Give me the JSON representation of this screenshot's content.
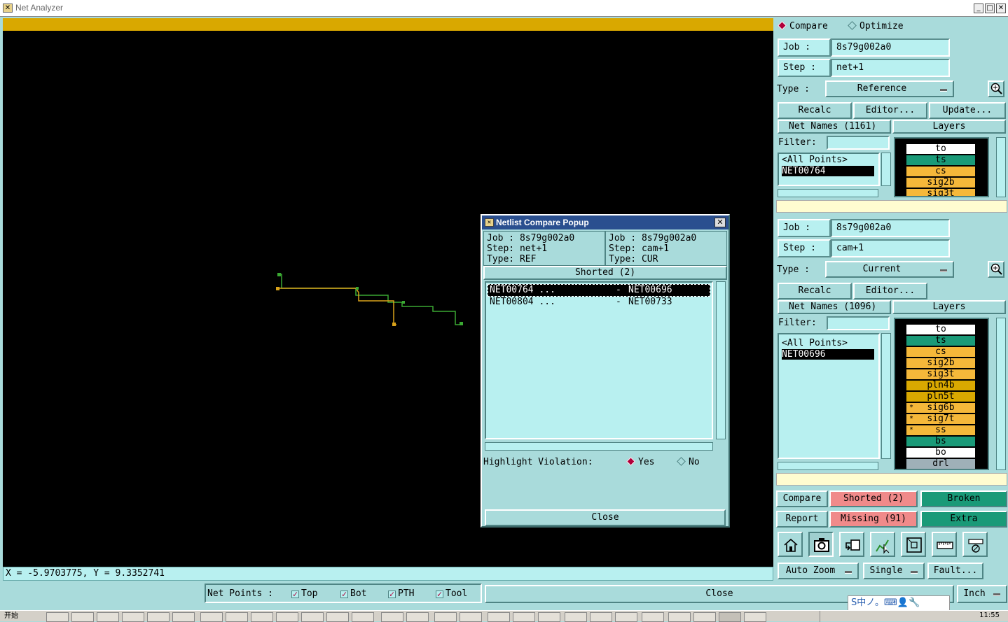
{
  "window": {
    "title": "Net Analyzer",
    "icon_name": "app-icon"
  },
  "canvas": {
    "coord_readout": "X = -5.9703775, Y = 9.3352741"
  },
  "mode": {
    "compare_label": "Compare",
    "optimize_label": "Optimize",
    "selected": "Compare"
  },
  "ref": {
    "job_label": "Job  :",
    "job_value": "8s79g002a0",
    "step_label": "Step  :",
    "step_value": "net+1",
    "type_label": "Type  :",
    "type_value": "Reference",
    "recalc": "Recalc",
    "editor": "Editor...",
    "update": "Update...",
    "net_names": "Net Names (1161)",
    "layers_header": "Layers",
    "filter_label": "Filter:",
    "nets": [
      "<All Points>",
      "NET00764"
    ],
    "layers": [
      {
        "name": "to",
        "color": "#ffffff",
        "star": ""
      },
      {
        "name": "ts",
        "color": "#1a9a78",
        "star": ""
      },
      {
        "name": "cs",
        "color": "#f5b83a",
        "star": ""
      },
      {
        "name": "sig2b",
        "color": "#f5b83a",
        "star": ""
      },
      {
        "name": "sig3t",
        "color": "#f5b83a",
        "star": ""
      }
    ]
  },
  "cur": {
    "job_label": "Job  :",
    "job_value": "8s79g002a0",
    "step_label": "Step  :",
    "step_value": "cam+1",
    "type_label": "Type  :",
    "type_value": "Current",
    "recalc": "Recalc",
    "editor": "Editor...",
    "net_names": "Net Names (1096)",
    "layers_header": "Layers",
    "filter_label": "Filter:",
    "nets": [
      "<All Points>",
      "NET00696"
    ],
    "layers": [
      {
        "name": "to",
        "color": "#ffffff",
        "star": ""
      },
      {
        "name": "ts",
        "color": "#1a9a78",
        "star": ""
      },
      {
        "name": "cs",
        "color": "#f5b83a",
        "star": ""
      },
      {
        "name": "sig2b",
        "color": "#f5b83a",
        "star": ""
      },
      {
        "name": "sig3t",
        "color": "#f5b83a",
        "star": ""
      },
      {
        "name": "pln4b",
        "color": "#d9a800",
        "star": ""
      },
      {
        "name": "pln5t",
        "color": "#d9a800",
        "star": ""
      },
      {
        "name": "sig6b",
        "color": "#f5b83a",
        "star": "*"
      },
      {
        "name": "sig7t",
        "color": "#f5b83a",
        "star": "*"
      },
      {
        "name": "ss",
        "color": "#f5b83a",
        "star": "*"
      },
      {
        "name": "bs",
        "color": "#1a9a78",
        "star": ""
      },
      {
        "name": "bo",
        "color": "#ffffff",
        "star": ""
      },
      {
        "name": "drl",
        "color": "#9fb0b8",
        "star": ""
      }
    ]
  },
  "results": {
    "compare": "Compare",
    "shorted": "Shorted (2)",
    "broken": "Broken",
    "report": "Report",
    "missing": "Missing (91)",
    "extra": "Extra",
    "error_color": "#f08a8a",
    "ok_color": "#1a9a78"
  },
  "tools": {
    "icons": [
      "home-icon",
      "camera-icon",
      "undo-icon",
      "net-select-icon",
      "window-icon",
      "ruler-icon",
      "measure-icon"
    ],
    "auto_zoom": "Auto Zoom",
    "single": "Single",
    "fault": "Fault..."
  },
  "bottom": {
    "net_points_label": "Net Points :",
    "checks": [
      {
        "label": "Top",
        "checked": true
      },
      {
        "label": "Bot",
        "checked": true
      },
      {
        "label": "PTH",
        "checked": true
      },
      {
        "label": "Tool",
        "checked": true
      }
    ],
    "close": "Close",
    "units": "Inch"
  },
  "popup": {
    "title": "Netlist Compare Popup",
    "left": {
      "job": "Job : 8s79g002a0",
      "step": "Step: net+1",
      "type": "Type: REF"
    },
    "right": {
      "job": "Job : 8s79g002a0",
      "step": "Step: cam+1",
      "type": "Type: CUR"
    },
    "section": "Shorted (2)",
    "rows": [
      {
        "ref": "NET00764 ...",
        "sep": "-",
        "cur": "NET00696"
      },
      {
        "ref": "NET00804 ...",
        "sep": "-",
        "cur": "NET00733"
      }
    ],
    "highlight_label": "Highlight Violation:",
    "yes": "Yes",
    "no": "No",
    "close": "Close"
  },
  "taskbar": {
    "start": "开始",
    "clock": "11:55"
  },
  "ime": {
    "text": "S中ノ。⌨👤🔧"
  }
}
